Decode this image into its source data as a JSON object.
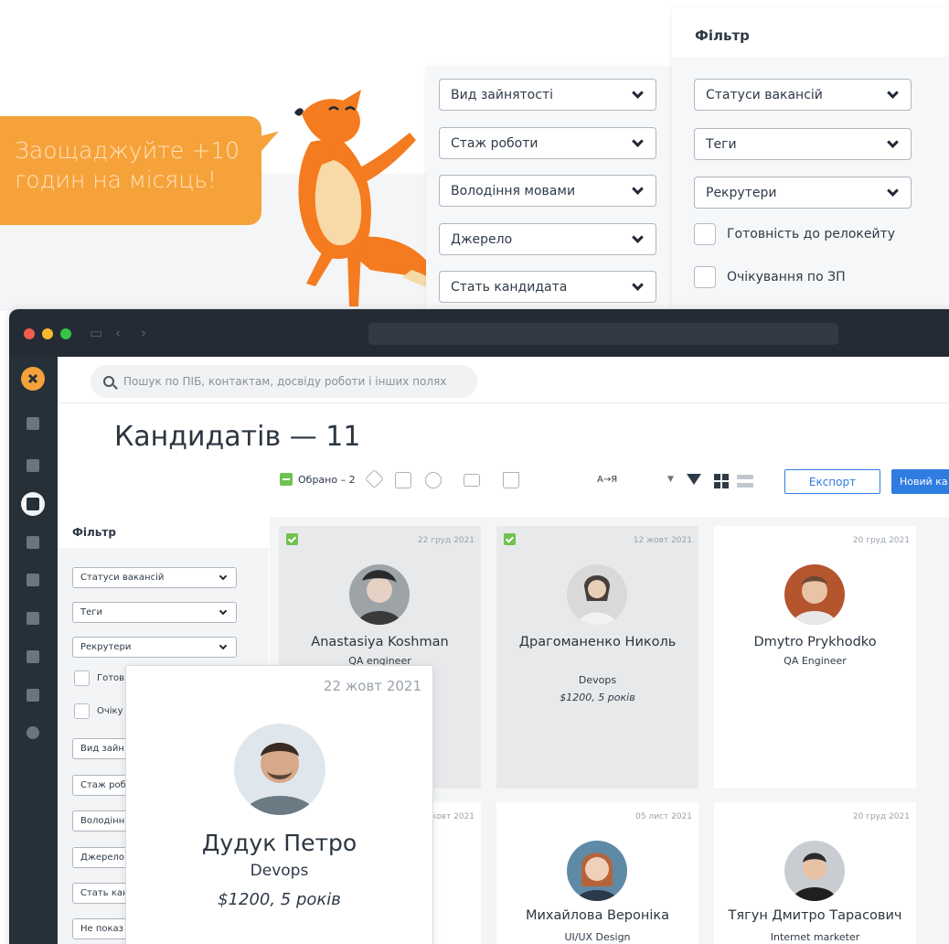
{
  "promo": {
    "text": "Заощаджуйте +10\nгодин на місяць!"
  },
  "mascot": {
    "icon": "fox-mascot-icon"
  },
  "colors": {
    "accent_orange": "#f6a23a",
    "primary_blue": "#2f7de1",
    "selected_green": "#6fc24f",
    "sidebar_dark": "#263039"
  },
  "filter_left": {
    "selects": [
      "Вид зайнятості",
      "Стаж роботи",
      "Володіння мовами",
      "Джерело",
      "Стать кандидата"
    ]
  },
  "filter_right": {
    "title": "Фільтр",
    "selects": [
      "Статуси вакансій",
      "Теги",
      "Рекрутери"
    ],
    "checkboxes": [
      "Готовність до релокейту",
      "Очікування по ЗП"
    ]
  },
  "browser": {
    "nav_icons": [
      "sidebar-toggle-icon",
      "back-icon",
      "forward-icon"
    ]
  },
  "search": {
    "placeholder": "Пошук по ПІБ, контактам, досвіду роботи і інших полях"
  },
  "page": {
    "title": "Кандидатів — 11"
  },
  "toolbar": {
    "selected_label": "Обрано – 2",
    "sort_label": "А→Я",
    "export_label": "Експорт",
    "new_label": "Новий ка"
  },
  "filter_panel": {
    "title": "Фільтр",
    "selects": [
      "Статуси вакансій",
      "Теги",
      "Рекрутери"
    ],
    "checkboxes": [
      "Готов",
      "Очіку"
    ],
    "selects_more": [
      "Вид зайн",
      "Стаж роб",
      "Володінн",
      "Джерело",
      "Стать кан",
      "Не показ"
    ]
  },
  "candidates": [
    {
      "name": "Anastasiya Koshman",
      "role": "QA engineer",
      "salary": "",
      "date": "22 груд 2021",
      "selected": true
    },
    {
      "name": "Драгоманенко Николь",
      "role": "Devops",
      "salary": "$1200, 5 років",
      "date": "12 жовт 2021",
      "selected": true
    },
    {
      "name": "Dmytro Prykhodko",
      "role": "QA Engineer",
      "salary": "",
      "date": "20 груд 2021",
      "selected": false
    },
    {
      "name": "",
      "role": "",
      "salary": "",
      "date": "жовт 2021",
      "selected": false
    },
    {
      "name": "Михайлова Вероніка",
      "role": "UI/UX Design",
      "salary": "",
      "date": "05 лист 2021",
      "selected": false
    },
    {
      "name": "Тягун Дмитро Тарасович",
      "role": "Internet marketer",
      "salary": "",
      "date": "20 груд 2021",
      "selected": false
    }
  ],
  "hover_card": {
    "name": "Дудук Петро",
    "role": "Devops",
    "salary": "$1200, 5 років",
    "date": "22 жовт 2021"
  }
}
